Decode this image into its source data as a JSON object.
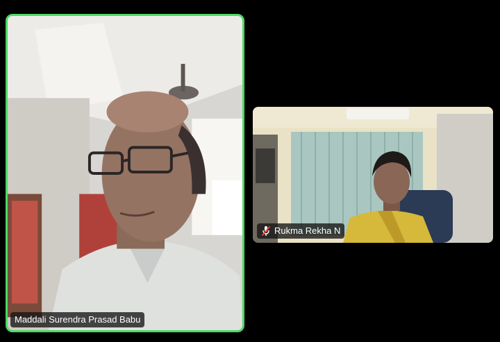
{
  "app": {
    "background": "#000000",
    "active_speaker_border": "#4cd964"
  },
  "participants": [
    {
      "name": "Maddali Surendra Prasad Babu",
      "active_speaker": true,
      "muted": false
    },
    {
      "name": "Rukma Rekha N",
      "active_speaker": false,
      "muted": true,
      "status_icon": "mic-muted-icon"
    }
  ]
}
